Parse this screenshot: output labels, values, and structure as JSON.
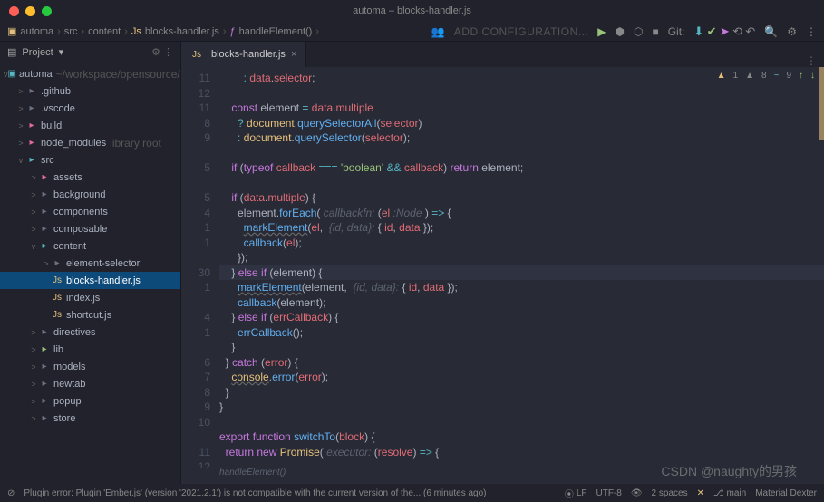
{
  "title": "automa – blocks-handler.js",
  "breadcrumbs": [
    "automa",
    "src",
    "content",
    "blocks-handler.js",
    "handleElement()"
  ],
  "toolbar": {
    "add_config": "ADD CONFIGURATION...",
    "git_label": "Git:"
  },
  "sidebar": {
    "header": "Project",
    "root_name": "automa",
    "root_path": "~/workspace/opensource/",
    "items": [
      {
        "indent": 1,
        "chev": ">",
        "icon": "folder",
        "iconClass": "folder",
        "label": ".github"
      },
      {
        "indent": 1,
        "chev": ">",
        "icon": "folder",
        "iconClass": "folder",
        "label": ".vscode"
      },
      {
        "indent": 1,
        "chev": ">",
        "icon": "folder",
        "iconClass": "pink",
        "label": "build"
      },
      {
        "indent": 1,
        "chev": ">",
        "icon": "folder",
        "iconClass": "pink",
        "label": "node_modules",
        "dim": "library root"
      },
      {
        "indent": 1,
        "chev": "v",
        "icon": "folder",
        "iconClass": "teal",
        "label": "src"
      },
      {
        "indent": 2,
        "chev": ">",
        "icon": "folder",
        "iconClass": "pink",
        "label": "assets"
      },
      {
        "indent": 2,
        "chev": ">",
        "icon": "folder",
        "iconClass": "folder",
        "label": "background"
      },
      {
        "indent": 2,
        "chev": ">",
        "icon": "folder",
        "iconClass": "folder",
        "label": "components"
      },
      {
        "indent": 2,
        "chev": ">",
        "icon": "folder",
        "iconClass": "folder",
        "label": "composable"
      },
      {
        "indent": 2,
        "chev": "v",
        "icon": "folder",
        "iconClass": "teal",
        "label": "content"
      },
      {
        "indent": 3,
        "chev": ">",
        "icon": "folder",
        "iconClass": "folder",
        "label": "element-selector"
      },
      {
        "indent": 3,
        "chev": "",
        "icon": "js",
        "iconClass": "yel",
        "label": "blocks-handler.js",
        "sel": true
      },
      {
        "indent": 3,
        "chev": "",
        "icon": "js",
        "iconClass": "yel",
        "label": "index.js"
      },
      {
        "indent": 3,
        "chev": "",
        "icon": "js",
        "iconClass": "yel",
        "label": "shortcut.js"
      },
      {
        "indent": 2,
        "chev": ">",
        "icon": "folder",
        "iconClass": "folder",
        "label": "directives"
      },
      {
        "indent": 2,
        "chev": ">",
        "icon": "folder",
        "iconClass": "grn",
        "label": "lib"
      },
      {
        "indent": 2,
        "chev": ">",
        "icon": "folder",
        "iconClass": "folder",
        "label": "models"
      },
      {
        "indent": 2,
        "chev": ">",
        "icon": "folder",
        "iconClass": "folder",
        "label": "newtab"
      },
      {
        "indent": 2,
        "chev": ">",
        "icon": "folder",
        "iconClass": "folder",
        "label": "popup"
      },
      {
        "indent": 2,
        "chev": ">",
        "icon": "folder",
        "iconClass": "folder",
        "label": "store"
      }
    ]
  },
  "tab": {
    "icon": "js",
    "name": "blocks-handler.js"
  },
  "inspections": {
    "warn_a": "1",
    "warn_b": "8",
    "weak": "9"
  },
  "gutter": [
    "11",
    "12",
    "11",
    "8",
    "9",
    "",
    "5",
    "",
    "5",
    "4",
    "1",
    "1",
    "",
    "30",
    "1",
    "",
    "4",
    "1",
    "",
    "6",
    "7",
    "8",
    "9",
    "10",
    "",
    "11",
    "12",
    ""
  ],
  "code_breadcrumb": "handleElement()",
  "statusbar": {
    "error": "Plugin error: Plugin 'Ember.js' (version '2021.2.1') is not compatible with the current version of the... (6 minutes ago)",
    "lf": "LF",
    "enc": "UTF-8",
    "spaces": "2 spaces",
    "branch": "main",
    "material": "Material Dexter"
  },
  "watermark": "CSDN @naughty的男孩"
}
